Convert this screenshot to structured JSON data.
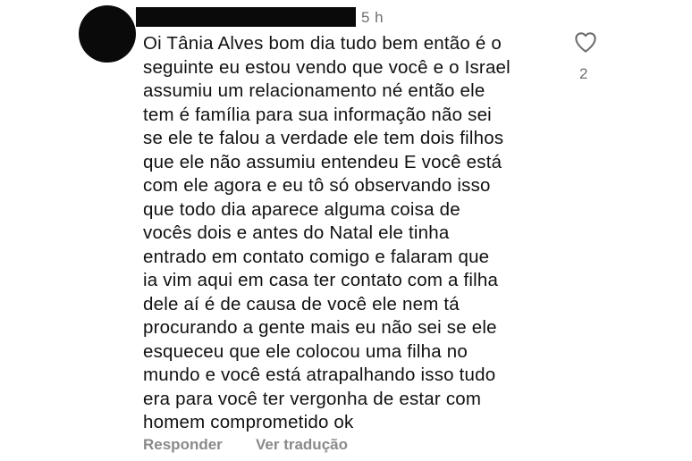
{
  "comment": {
    "timestamp": "5 h",
    "lines": [
      "Oi Tânia Alves bom dia tudo bem então é o",
      "seguinte eu estou vendo que você e o Israel",
      "assumiu um relacionamento né então ele",
      "tem é família para sua informação não sei",
      "se ele te falou a verdade ele tem dois filhos",
      "que ele não assumiu entendeu E você está",
      "com ele agora e eu tô só observando isso",
      "que todo dia aparece alguma coisa de",
      "vocês dois e antes do Natal ele tinha",
      "entrado em contato comigo e falaram que",
      "ia vim aqui em casa ter contato com a filha",
      "dele aí é de causa de você ele nem tá",
      "procurando a gente mais eu não sei se ele",
      "esqueceu que ele colocou uma filha no",
      "mundo e você está atrapalhando isso tudo",
      "era para você ter vergonha de estar com",
      "homem comprometido ok"
    ],
    "like_count": "2",
    "like_icon": "heart-outline-icon",
    "reply_label": "Responder",
    "translate_label": "Ver tradução"
  },
  "colors": {
    "text": "#111111",
    "secondary": "#6f6f6f",
    "actions": "#8a8a8a",
    "avatar": "#0a0a0a",
    "redaction": "#0a0a0a"
  }
}
